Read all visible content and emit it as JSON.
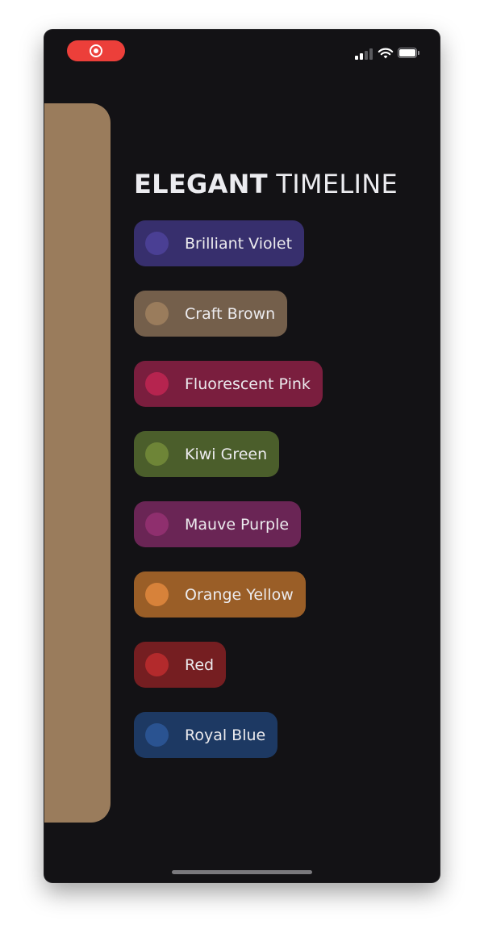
{
  "status_bar": {
    "record_icon": "screen-record-icon",
    "signal_icon": "cellular-signal-icon",
    "wifi_icon": "wifi-icon",
    "battery_icon": "battery-icon"
  },
  "colors": {
    "background": "#131215",
    "side_card": "#9a7c5c",
    "record_pill": "#ec3f3a"
  },
  "title": {
    "bold": "ELEGANT",
    "light": "TIMELINE"
  },
  "color_items": [
    {
      "label": "Brilliant Violet",
      "chip_color": "#372f6d",
      "swatch_color": "#4a3f94"
    },
    {
      "label": "Craft Brown",
      "chip_color": "#745f4b",
      "swatch_color": "#9a7c5c"
    },
    {
      "label": "Fluorescent Pink",
      "chip_color": "#7a1e3e",
      "swatch_color": "#b6244f"
    },
    {
      "label": "Kiwi Green",
      "chip_color": "#4b5e2b",
      "swatch_color": "#6e8537"
    },
    {
      "label": "Mauve Purple",
      "chip_color": "#6a2555",
      "swatch_color": "#8f2f6e"
    },
    {
      "label": "Orange Yellow",
      "chip_color": "#9a5e27",
      "swatch_color": "#d7823a"
    },
    {
      "label": "Red",
      "chip_color": "#751e21",
      "swatch_color": "#b32a2c"
    },
    {
      "label": "Royal Blue",
      "chip_color": "#1d3963",
      "swatch_color": "#2a5391"
    }
  ]
}
